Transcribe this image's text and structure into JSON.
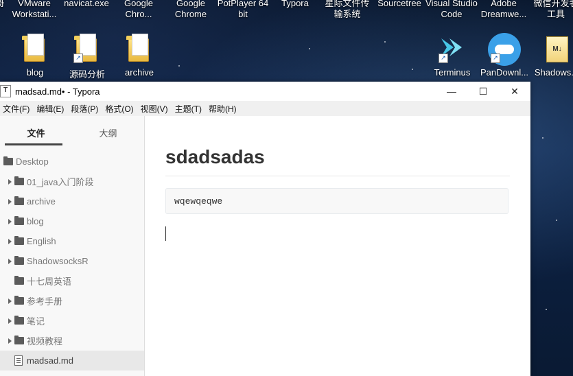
{
  "desktop": {
    "top_row": [
      {
        "label": "哥"
      },
      {
        "label": "VMware Workstati..."
      },
      {
        "label": "navicat.exe"
      },
      {
        "label": "Google Chro..."
      },
      {
        "label": "Google Chrome"
      },
      {
        "label": "PotPlayer 64 bit"
      },
      {
        "label": "Typora"
      },
      {
        "label": "星际文件传输系统"
      },
      {
        "label": "Sourcetree"
      },
      {
        "label": "Visual Studio Code"
      },
      {
        "label": "Adobe Dreamwe..."
      },
      {
        "label": "微信开发者工具"
      }
    ],
    "icons": [
      {
        "label": "blog",
        "icon": "folder-icon"
      },
      {
        "label": "源码分析",
        "icon": "folder-shortcut-icon"
      },
      {
        "label": "archive",
        "icon": "folder-icon"
      },
      {
        "label": "Terminus",
        "icon": "terminus-icon"
      },
      {
        "label": "PanDownl...",
        "icon": "cloud-icon"
      },
      {
        "label": "Shadows...",
        "icon": "markdown-file-icon"
      }
    ]
  },
  "window": {
    "app_icon": "T",
    "title": "madsad.md• - Typora",
    "buttons": {
      "minimize": "—",
      "maximize": "☐",
      "close": "✕"
    },
    "menu": [
      "文件(F)",
      "编辑(E)",
      "段落(P)",
      "格式(O)",
      "视图(V)",
      "主题(T)",
      "帮助(H)"
    ]
  },
  "sidebar": {
    "tabs": [
      {
        "label": "文件",
        "active": true
      },
      {
        "label": "大纲",
        "active": false
      }
    ],
    "root": "Desktop",
    "items": [
      {
        "label": "01_java入门阶段",
        "type": "folder",
        "expandable": true
      },
      {
        "label": "archive",
        "type": "folder",
        "expandable": true
      },
      {
        "label": "blog",
        "type": "folder",
        "expandable": true
      },
      {
        "label": "English",
        "type": "folder",
        "expandable": true
      },
      {
        "label": "ShadowsocksR",
        "type": "folder",
        "expandable": true
      },
      {
        "label": "十七周英语",
        "type": "folder",
        "expandable": false
      },
      {
        "label": "参考手册",
        "type": "folder",
        "expandable": true
      },
      {
        "label": "笔记",
        "type": "folder",
        "expandable": true
      },
      {
        "label": "视频教程",
        "type": "folder",
        "expandable": true
      },
      {
        "label": "madsad.md",
        "type": "file",
        "expandable": false,
        "active": true
      }
    ]
  },
  "editor": {
    "heading": "sdadsadas",
    "code": "wqewqeqwe"
  }
}
